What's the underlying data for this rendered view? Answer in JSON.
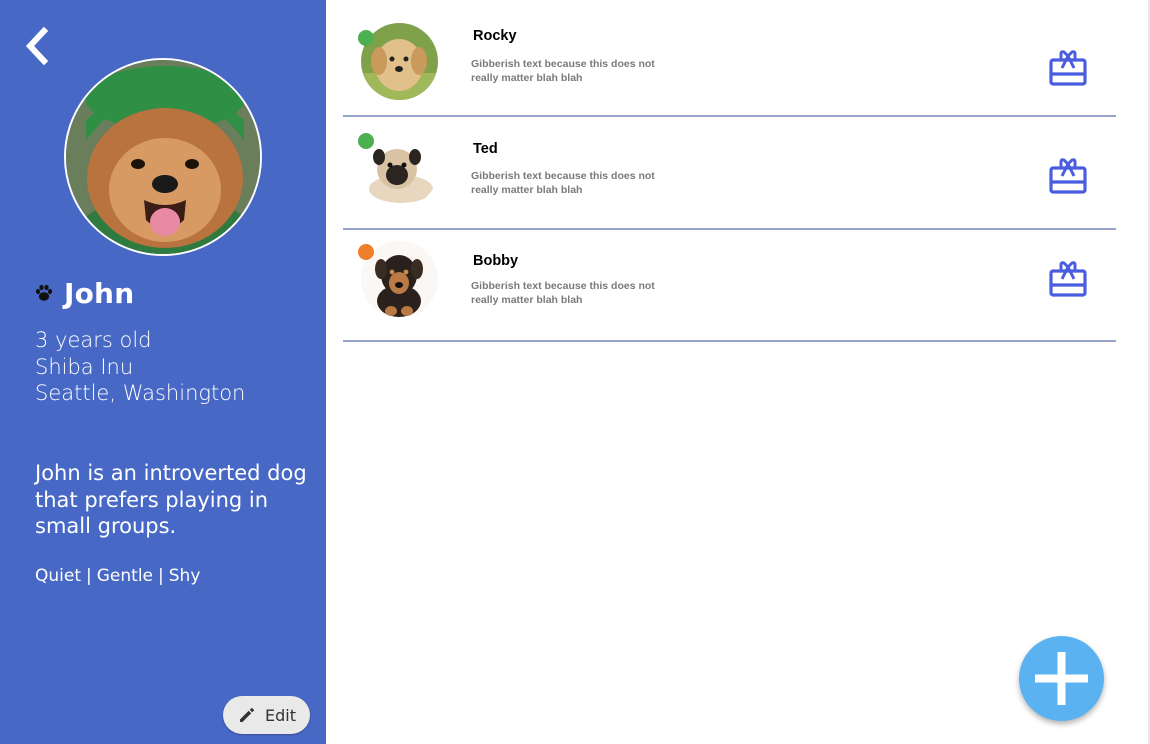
{
  "theme": {
    "sidebar_bg": "#4868c6",
    "accent_blue": "#4a5ce0",
    "fab_color": "#5ab3f0",
    "status_online": "#4caf50",
    "status_away": "#f07f2c"
  },
  "profile": {
    "back_icon": "chevron-left-icon",
    "name_icon": "paw-icon",
    "name": "John",
    "age": "3 years old",
    "breed": "Shiba Inu",
    "location": "Seattle, Washington",
    "bio": "John is an introverted dog that prefers playing in small groups.",
    "tags": [
      "Quiet",
      "|",
      "Gentle",
      "|",
      "Shy"
    ],
    "edit_label": "Edit",
    "edit_icon": "pencil-icon"
  },
  "friends": [
    {
      "name": "Rocky",
      "description": "Gibberish text because this does not really matter blah blah",
      "status_color": "#4caf50",
      "action_icon": "gift-card-icon"
    },
    {
      "name": "Ted",
      "description": "Gibberish text because this does not really matter blah blah",
      "status_color": "#4caf50",
      "action_icon": "gift-card-icon"
    },
    {
      "name": "Bobby",
      "description": "Gibberish text because this does not really matter blah blah",
      "status_color": "#f07f2c",
      "action_icon": "gift-card-icon"
    }
  ],
  "fab": {
    "icon": "plus-icon"
  }
}
